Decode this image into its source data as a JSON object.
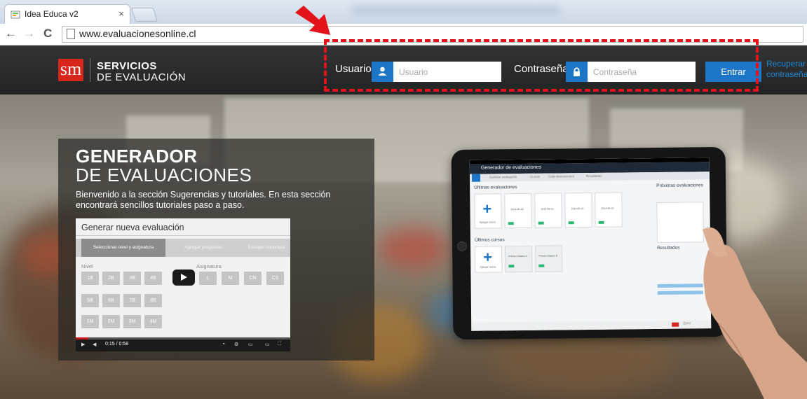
{
  "browser": {
    "tab_title": "Idea Educa v2",
    "close_glyph": "×",
    "url": "www.evaluacionesonline.cl",
    "back_glyph": "←",
    "forward_glyph": "→",
    "reload_glyph": "C"
  },
  "header": {
    "logo": "sm",
    "brand_line1": "SERVICIOS",
    "brand_line2": "DE EVALUACIÓN",
    "user_label": "Usuario",
    "user_placeholder": "Usuario",
    "password_label": "Contraseña",
    "password_placeholder": "Contraseña",
    "login_button": "Entrar",
    "recover_line1": "Recuperar",
    "recover_line2": "contraseña"
  },
  "video_card": {
    "title": "GENERADOR",
    "subtitle": "DE EVALUACIONES",
    "description": "Bienvenido a la sección Sugerencias y tutoriales. En esta sección encontrará sencillos tutoriales paso a paso.",
    "player": {
      "title": "Generar nueva evaluación",
      "steps": [
        "Seleccionar nivel y asignatura",
        "Agregar preguntas",
        "Escoger cobertura"
      ],
      "nivel_label": "Nivel",
      "asignatura_label": "Asignatura",
      "niveles": [
        "1B",
        "2B",
        "3B",
        "4B",
        "5B",
        "6B",
        "7B",
        "8B",
        "1M",
        "2M",
        "3M",
        "4M"
      ],
      "asignaturas": [
        "L",
        "M",
        "CN",
        "CS"
      ],
      "time": "0:15 / 0:58"
    }
  },
  "tablet": {
    "app_title": "Generador de evaluaciones",
    "nav": [
      "Generar evaluación",
      "Cursos",
      "Calendarizaciones",
      "Resultados"
    ],
    "section_evaluations": "Últimas evaluaciones",
    "section_courses": "Últimos cursos",
    "section_calendar": "Próximas evaluaciones",
    "section_results": "Resultados",
    "add_label": "Agregar nueva",
    "cards": [
      "2014-05-18",
      "2014-05-15",
      "2014-05-15",
      "2014-05-15"
    ],
    "courses": [
      "Primero Básico A",
      "Primero Básico B"
    ],
    "footer_brand": "ibee"
  },
  "colors": {
    "accent_blue": "#1d75c8",
    "brand_red": "#d8261c",
    "highlight_red": "#e3131b",
    "header_dark": "#2a2b2c"
  },
  "icons": {
    "user_icon": "user-icon",
    "lock_icon": "lock-icon",
    "play_icon": "play-icon"
  }
}
